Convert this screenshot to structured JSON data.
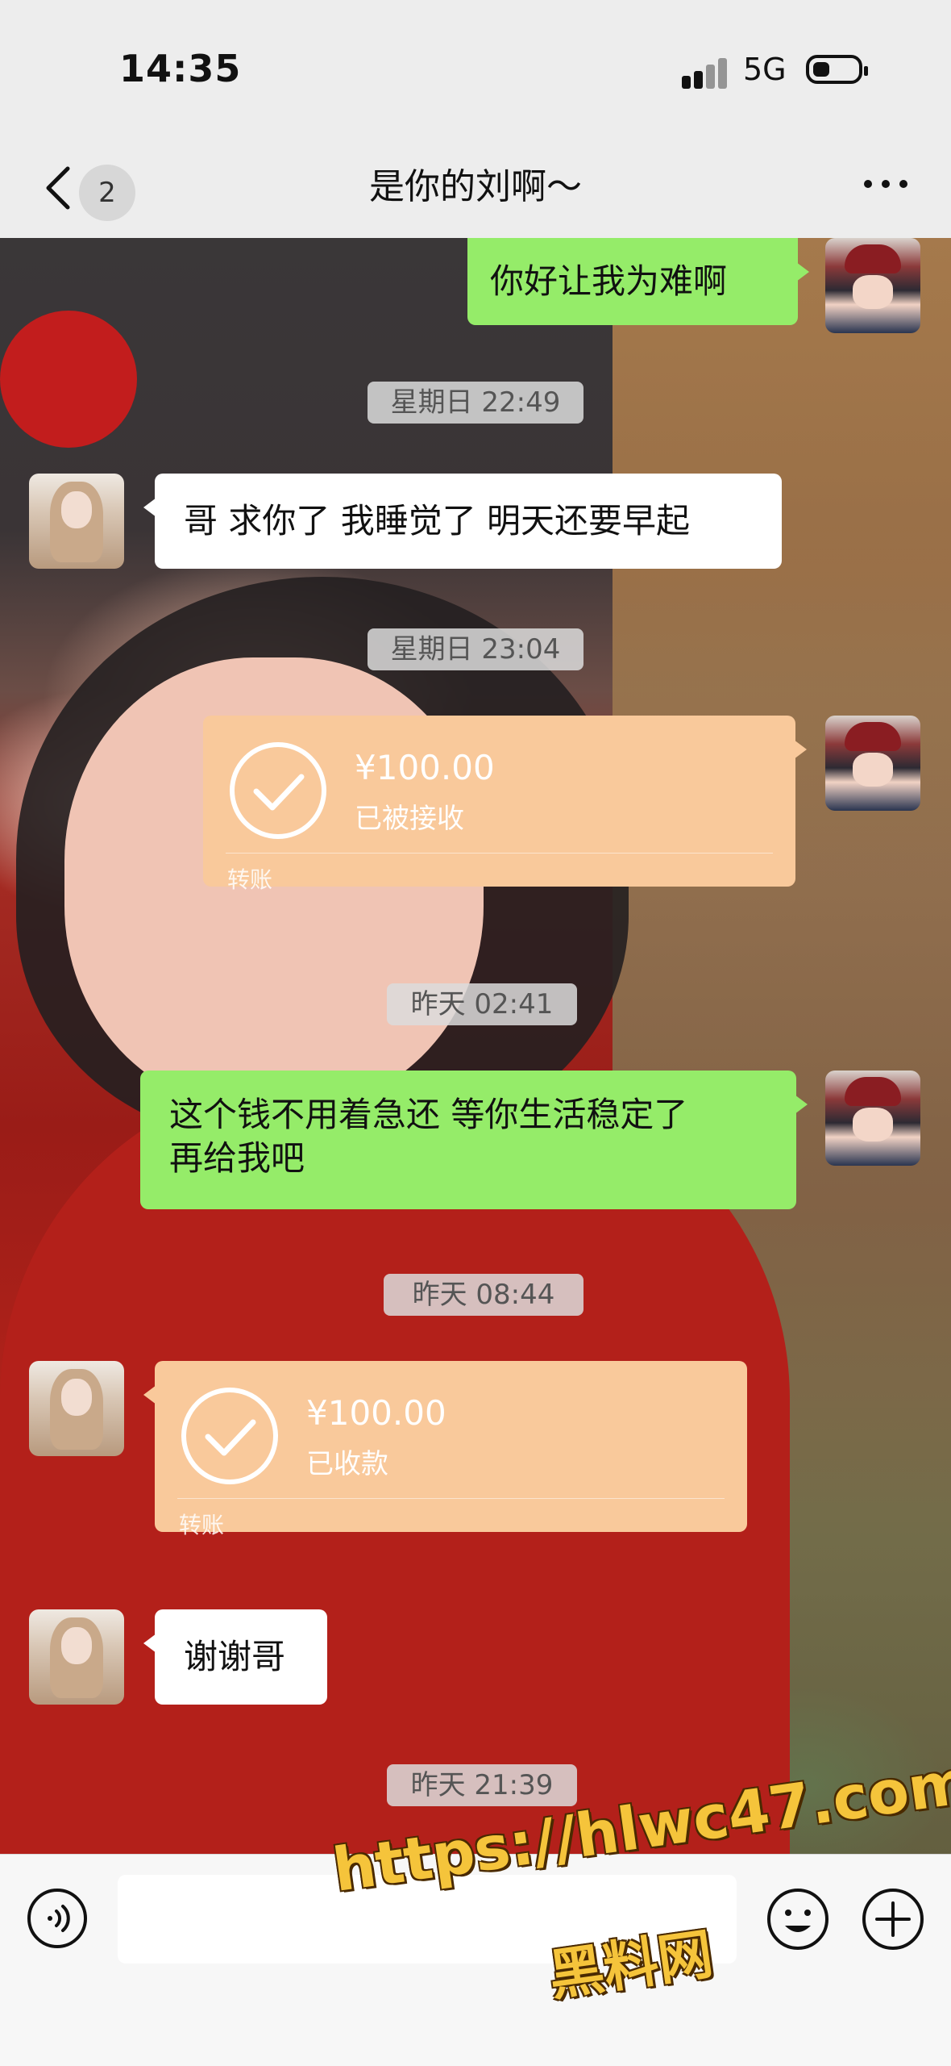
{
  "status_bar": {
    "time": "14:35",
    "network": "5G",
    "battery_level": 0.25
  },
  "header": {
    "back_icon": "chevron-left-icon",
    "unread_count": "2",
    "title": "是你的刘啊～",
    "more_icon": "more-icon"
  },
  "messages": [
    {
      "type": "text",
      "side": "right",
      "text": "你好让我为难啊"
    },
    {
      "type": "timestamp",
      "text": "星期日 22:49"
    },
    {
      "type": "text",
      "side": "left",
      "text": "哥 求你了 我睡觉了 明天还要早起"
    },
    {
      "type": "timestamp",
      "text": "星期日 23:04"
    },
    {
      "type": "transfer",
      "side": "right",
      "amount": "¥100.00",
      "status": "已被接收",
      "kind": "转账"
    },
    {
      "type": "timestamp",
      "text": "昨天 02:41"
    },
    {
      "type": "text",
      "side": "right",
      "text": "这个钱不用着急还  等你生活稳定了再给我吧",
      "line1": "这个钱不用着急还  等你生活稳定了",
      "line2": "再给我吧"
    },
    {
      "type": "timestamp",
      "text": "昨天 08:44"
    },
    {
      "type": "transfer",
      "side": "left",
      "amount": "¥100.00",
      "status": "已收款",
      "kind": "转账"
    },
    {
      "type": "text",
      "side": "left",
      "text": "谢谢哥"
    },
    {
      "type": "timestamp",
      "text": "昨天 21:39"
    }
  ],
  "input_bar": {
    "voice_icon": "voice-icon",
    "input_value": "",
    "emoji_icon": "emoji-icon",
    "plus_icon": "plus-icon"
  },
  "watermark": {
    "url": "https://hlwc47.com",
    "name": "黑料网"
  },
  "colors": {
    "my_bubble": "#95ec69",
    "their_bubble": "#ffffff",
    "transfer": "#f9c99b",
    "background": "#ededed"
  }
}
